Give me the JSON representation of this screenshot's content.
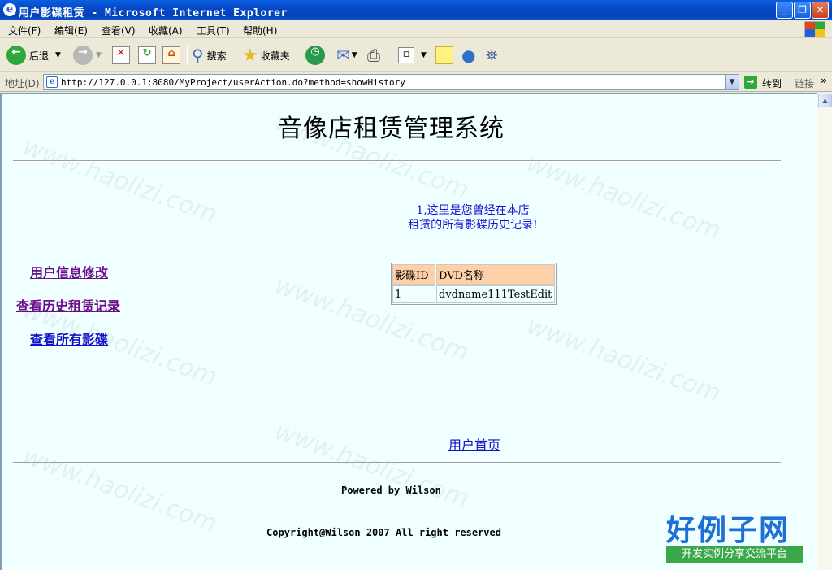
{
  "window": {
    "title": "用户影碟租赁 - Microsoft Internet Explorer"
  },
  "menu": [
    "文件(F)",
    "编辑(E)",
    "查看(V)",
    "收藏(A)",
    "工具(T)",
    "帮助(H)"
  ],
  "toolbar": {
    "back_label": "后退",
    "search_label": "搜索",
    "favorites_label": "收藏夹"
  },
  "address": {
    "label": "地址(D)",
    "url": "http://127.0.0.1:8080/MyProject/userAction.do?method=showHistory",
    "go_label": "转到",
    "links_label": "链接"
  },
  "page": {
    "title": "音像店租赁管理系统",
    "info_line1": "1,这里是您曾经在本店",
    "info_line2": "租赁的所有影碟历史记录!",
    "nav": [
      {
        "label": "用户信息修改"
      },
      {
        "label": "查看历史租赁记录"
      },
      {
        "label": "查看所有影碟"
      }
    ],
    "table": {
      "headers": [
        "影碟ID",
        "DVD名称"
      ],
      "rows": [
        [
          "1",
          "dvdname111TestEdit"
        ]
      ]
    },
    "home_link": "用户首页",
    "powered": "Powered by Wilson",
    "copyright": "Copyright@Wilson 2007 All right reserved"
  },
  "watermark": {
    "brand": "好例子网",
    "slogan": "开发实例分享交流平台",
    "site": "www.haolizi.com"
  },
  "colors": {
    "title_bar": "#0648c8",
    "content_bg": "#f0ffff",
    "table_header": "#fdd0a8",
    "link_visited": "#6a0d8a",
    "link": "#1010c8"
  }
}
